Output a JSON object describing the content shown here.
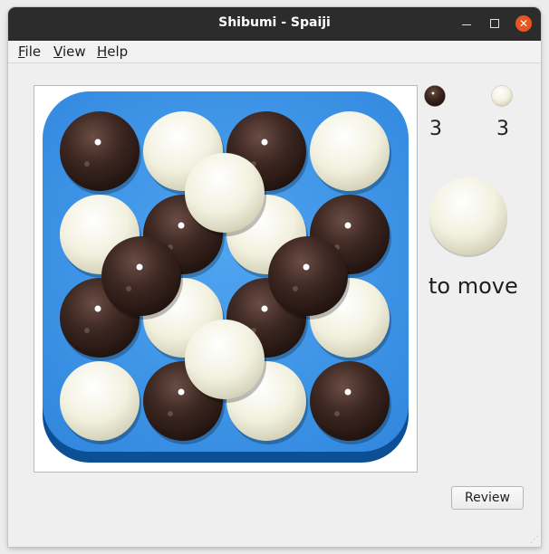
{
  "window": {
    "title": "Shibumi - Spaiji"
  },
  "menu": {
    "file": "File",
    "view": "View",
    "help": "Help"
  },
  "score": {
    "black_count": "3",
    "white_count": "3"
  },
  "status": {
    "to_move_label": "to move",
    "current_player": "white"
  },
  "buttons": {
    "review": "Review"
  },
  "board": {
    "size": 4,
    "colors": {
      "mat": "#3f96e6",
      "mat_edge": "#0d4f94",
      "black": "#3a2620",
      "white": "#efeed9"
    },
    "levels": [
      [
        [
          "black",
          "white",
          "black",
          "white"
        ],
        [
          "white",
          "black",
          "white",
          "black"
        ],
        [
          "black",
          "white",
          "black",
          "white"
        ],
        [
          "white",
          "black",
          "white",
          "black"
        ]
      ],
      [
        [
          null,
          "white",
          null
        ],
        [
          "black",
          null,
          "black"
        ],
        [
          null,
          "white",
          null
        ]
      ]
    ]
  }
}
